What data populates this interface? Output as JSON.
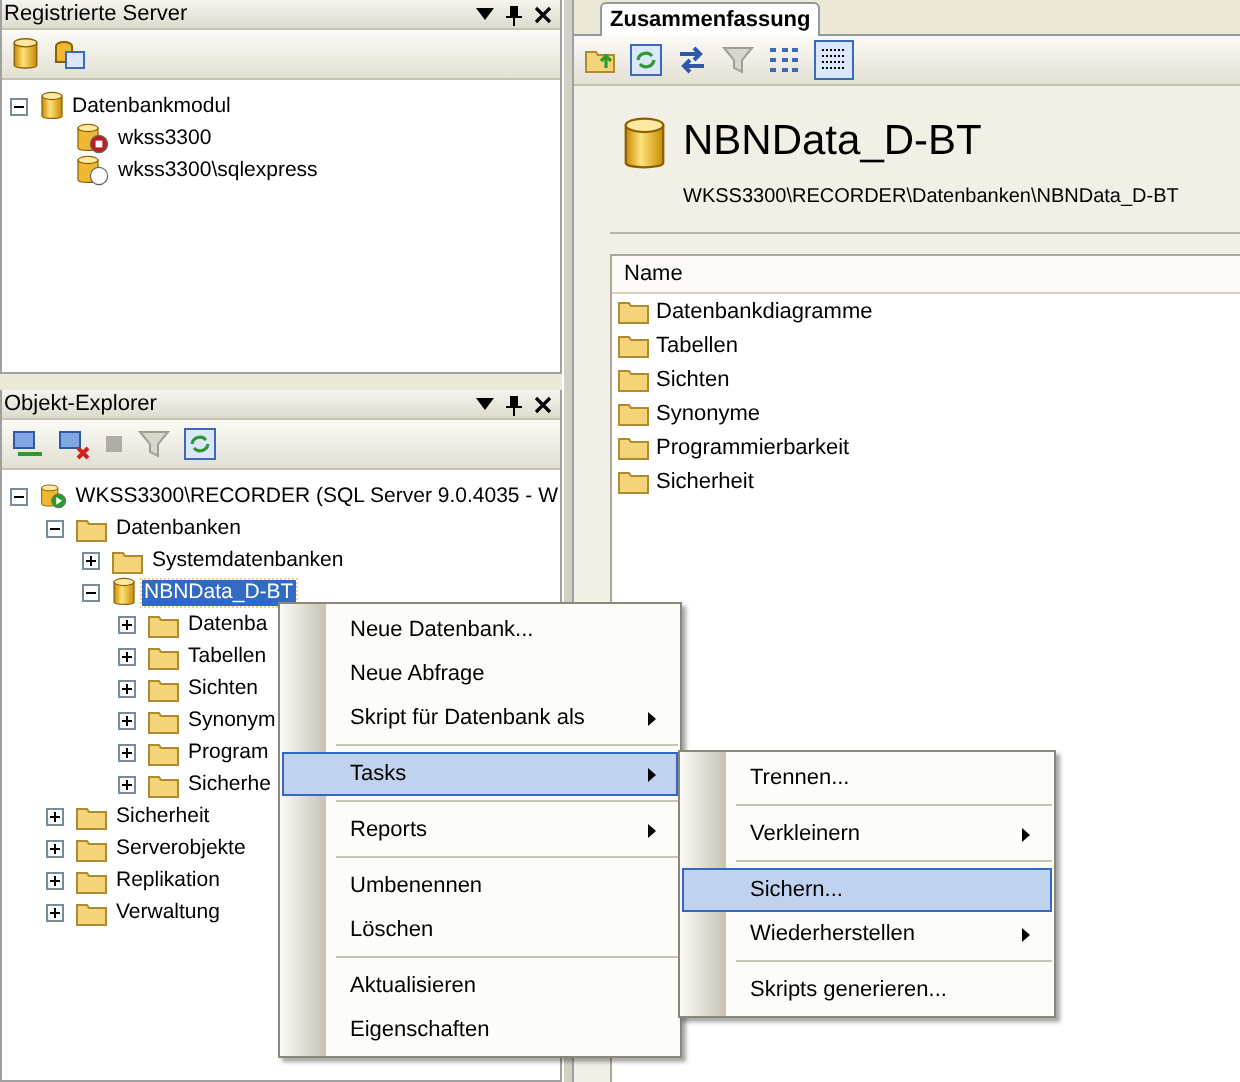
{
  "registered_servers": {
    "title": "Registrierte Server",
    "tree": [
      {
        "label": "Datenbankmodul",
        "kind": "database",
        "expanded": true,
        "selected": false,
        "children": [
          {
            "label": "wkss3300",
            "kind": "server-stopped",
            "selected": false
          },
          {
            "label": "wkss3300\\sqlexpress",
            "kind": "server-unknown",
            "selected": false
          }
        ]
      }
    ]
  },
  "object_explorer": {
    "title": "Objekt-Explorer",
    "tree": [
      {
        "label": "WKSS3300\\RECORDER (SQL Server 9.0.4035 - W",
        "kind": "server-running",
        "expanded": true,
        "selected": false,
        "children": [
          {
            "label": "Datenbanken",
            "kind": "folder",
            "expanded": true,
            "selected": false,
            "children": [
              {
                "label": "Systemdatenbanken",
                "kind": "folder",
                "expanded": false,
                "selected": false
              },
              {
                "label": "NBNData_D-BT",
                "kind": "database",
                "expanded": true,
                "selected": true,
                "children": [
                  {
                    "label": "Datenba",
                    "kind": "folder",
                    "expanded": false,
                    "selected": false
                  },
                  {
                    "label": "Tabellen",
                    "kind": "folder",
                    "expanded": false,
                    "selected": false
                  },
                  {
                    "label": "Sichten",
                    "kind": "folder",
                    "expanded": false,
                    "selected": false
                  },
                  {
                    "label": "Synonym",
                    "kind": "folder",
                    "expanded": false,
                    "selected": false
                  },
                  {
                    "label": "Program",
                    "kind": "folder",
                    "expanded": false,
                    "selected": false
                  },
                  {
                    "label": "Sicherhe",
                    "kind": "folder",
                    "expanded": false,
                    "selected": false
                  }
                ]
              }
            ]
          },
          {
            "label": "Sicherheit",
            "kind": "folder",
            "expanded": false,
            "selected": false
          },
          {
            "label": "Serverobjekte",
            "kind": "folder",
            "expanded": false,
            "selected": false
          },
          {
            "label": "Replikation",
            "kind": "folder",
            "expanded": false,
            "selected": false
          },
          {
            "label": "Verwaltung",
            "kind": "folder",
            "expanded": false,
            "selected": false
          }
        ]
      }
    ]
  },
  "summary": {
    "tab": "Zusammenfassung",
    "title": "NBNData_D-BT",
    "path": "WKSS3300\\RECORDER\\Datenbanken\\NBNData_D-BT",
    "list_header": "Name",
    "items": [
      "Datenbankdiagramme",
      "Tabellen",
      "Sichten",
      "Synonyme",
      "Programmierbarkeit",
      "Sicherheit"
    ]
  },
  "context_menu": [
    {
      "kind": "item",
      "label": "Neue Datenbank...",
      "submenu": false,
      "selected": false
    },
    {
      "kind": "item",
      "label": "Neue Abfrage",
      "submenu": false,
      "selected": false
    },
    {
      "kind": "item",
      "label": "Skript für Datenbank als",
      "submenu": true,
      "selected": false
    },
    {
      "kind": "separator"
    },
    {
      "kind": "item",
      "label": "Tasks",
      "submenu": true,
      "selected": true,
      "children": [
        {
          "kind": "item",
          "label": "Trennen...",
          "submenu": false,
          "selected": false
        },
        {
          "kind": "separator"
        },
        {
          "kind": "item",
          "label": "Verkleinern",
          "submenu": true,
          "selected": false
        },
        {
          "kind": "separator"
        },
        {
          "kind": "item",
          "label": "Sichern...",
          "submenu": false,
          "selected": true
        },
        {
          "kind": "item",
          "label": "Wiederherstellen",
          "submenu": true,
          "selected": false
        },
        {
          "kind": "separator"
        },
        {
          "kind": "item",
          "label": "Skripts generieren...",
          "submenu": false,
          "selected": false
        }
      ]
    },
    {
      "kind": "separator"
    },
    {
      "kind": "item",
      "label": "Reports",
      "submenu": true,
      "selected": false
    },
    {
      "kind": "separator"
    },
    {
      "kind": "item",
      "label": "Umbenennen",
      "submenu": false,
      "selected": false
    },
    {
      "kind": "item",
      "label": "Löschen",
      "submenu": false,
      "selected": false
    },
    {
      "kind": "separator"
    },
    {
      "kind": "item",
      "label": "Aktualisieren",
      "submenu": false,
      "selected": false
    },
    {
      "kind": "item",
      "label": "Eigenschaften",
      "submenu": false,
      "selected": false
    }
  ]
}
